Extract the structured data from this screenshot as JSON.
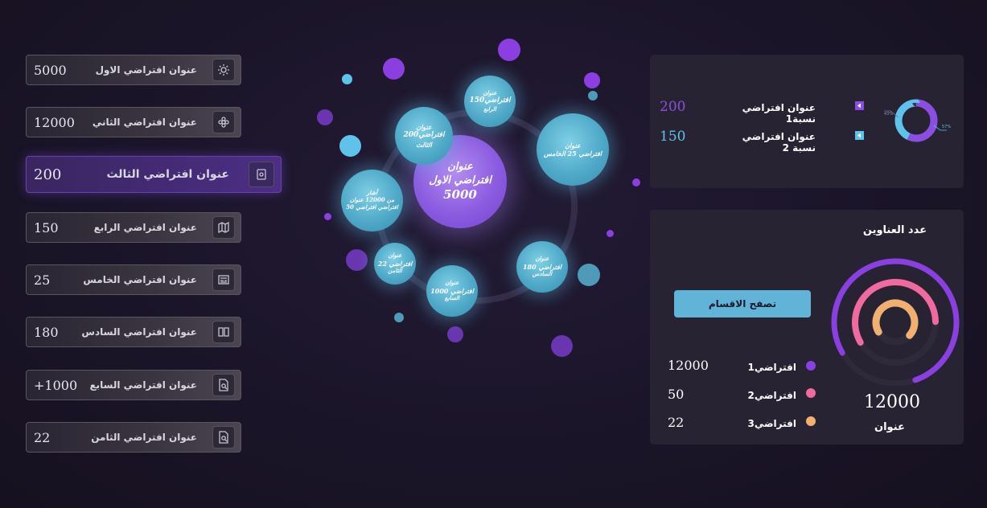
{
  "list": [
    {
      "value": "5000",
      "label": "عنوان افتراضي الاول",
      "icon": "gear-badge-icon"
    },
    {
      "value": "12000",
      "label": "عنوان افتراضي الثاني",
      "icon": "flower-icon"
    },
    {
      "value": "200",
      "label": "عنوان افتراضي الثالث",
      "icon": "book-icon",
      "active": true
    },
    {
      "value": "150",
      "label": "عنوان افتراضي الرابع",
      "icon": "map-icon"
    },
    {
      "value": "25",
      "label": "عنوان افتراضي الخامس",
      "icon": "newspaper-icon"
    },
    {
      "value": "180",
      "label": "عنوان افتراضي السادس",
      "icon": "open-book-icon"
    },
    {
      "value": "+1000",
      "label": "عنوان افتراضي السابع",
      "icon": "document-search-icon"
    },
    {
      "value": "22",
      "label": "عنوان افتراضي الثامن",
      "icon": "document-search-icon"
    }
  ],
  "bubbles": {
    "main": {
      "title": "عنوان",
      "line1": "افتراضي الاول",
      "value": "5000"
    },
    "b150": {
      "l1": "عنوان",
      "l2": "افتراضي150",
      "l3": "الرابع"
    },
    "b200": {
      "l1": "عنوان",
      "l2": "افتراضي200",
      "l3": "الثالث"
    },
    "b25": {
      "l1": "عنوان",
      "l2": "افتراضي 25 الخامس"
    },
    "b12000": {
      "l1": "أشار",
      "l2": "من 12000 عنوان",
      "l3": "50 افتراضي افتراضي"
    },
    "b180": {
      "l1": "عنوان",
      "l2": "افتراضي 180",
      "l3": "السادس"
    },
    "b22": {
      "l1": "عنوان",
      "l2": "افتراضي 22",
      "l3": "الثامن"
    },
    "b1000": {
      "l1": "عنوان",
      "l2": "افتراضي 1000",
      "l3": "السابع"
    }
  },
  "ratio_panel": {
    "rows": [
      {
        "label": "عنوان افتراضي نسبة1",
        "value": "200",
        "color": "#8a4fe0"
      },
      {
        "label": "عنوان افتراضي نسبة 2",
        "value": "150",
        "color": "#5ec2ea"
      }
    ],
    "donut": {
      "purple_pct": 57,
      "blue_pct": 43,
      "left_label": "43%",
      "right_label": "57%"
    }
  },
  "count_panel": {
    "title": "عدد العناوين",
    "browse_button": "تصفح الاقسام",
    "total": "12000",
    "total_label": "عنوان",
    "rows": [
      {
        "label": "افتراضي1",
        "value": "12000",
        "color": "#8a3fe0"
      },
      {
        "label": "افتراضي2",
        "value": "50",
        "color": "#f06aa0"
      },
      {
        "label": "افتراضي3",
        "value": "22",
        "color": "#f2b070"
      }
    ],
    "rings": {
      "outer_pct": 78,
      "middle_pct": 58,
      "inner_pct": 70
    }
  }
}
